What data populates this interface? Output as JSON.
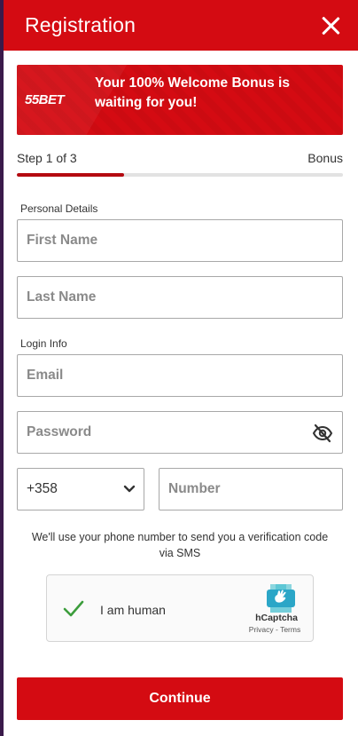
{
  "header": {
    "title": "Registration"
  },
  "banner": {
    "logo_text": "55BET",
    "message": "Your 100% Welcome Bonus is waiting for you!"
  },
  "progress": {
    "step_label": "Step 1 of 3",
    "next_label": "Bonus",
    "fraction": 0.33
  },
  "sections": {
    "personal": "Personal Details",
    "login": "Login Info"
  },
  "fields": {
    "first_name": {
      "placeholder": "First Name",
      "value": ""
    },
    "last_name": {
      "placeholder": "Last Name",
      "value": ""
    },
    "email": {
      "placeholder": "Email",
      "value": ""
    },
    "password": {
      "placeholder": "Password",
      "value": ""
    },
    "phone_code": "+358",
    "phone_number": {
      "placeholder": "Number",
      "value": ""
    }
  },
  "sms_note": "We'll use your phone number to send you a verification code via SMS",
  "captcha": {
    "label": "I am human",
    "brand": "hCaptcha",
    "links": "Privacy - Terms"
  },
  "continue_label": "Continue",
  "colors": {
    "brand_red": "#d40b12",
    "progress_red": "#b40a10",
    "check_green": "#3c9d3c"
  }
}
